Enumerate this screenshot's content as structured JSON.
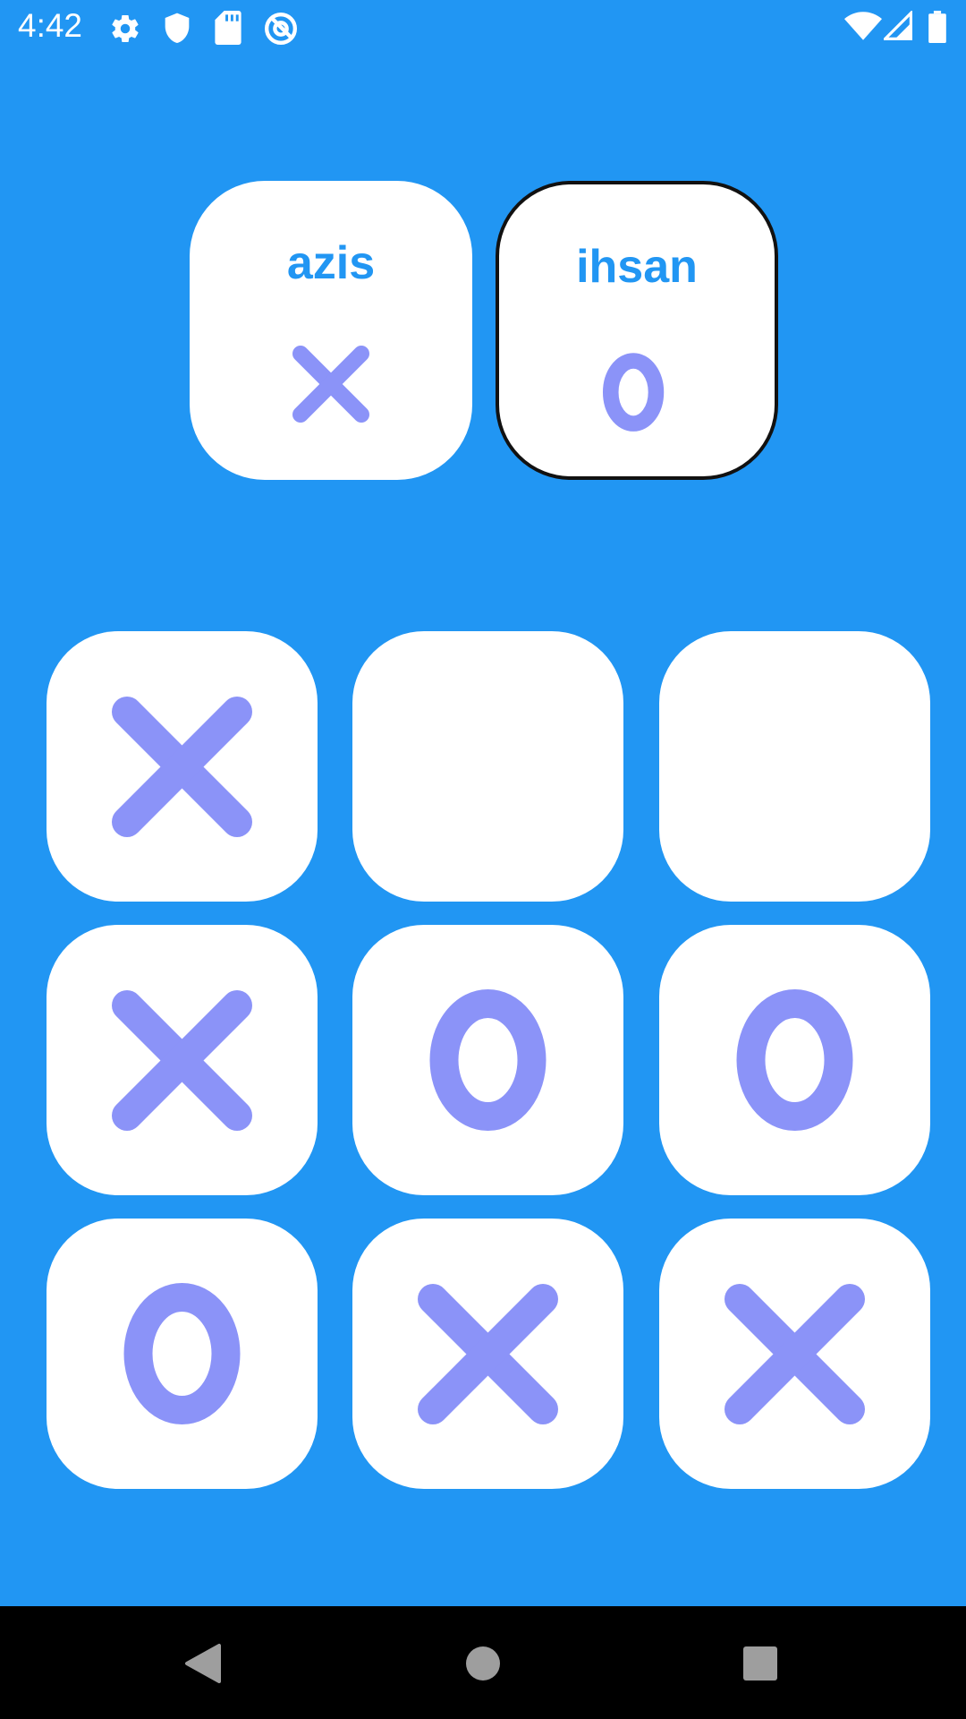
{
  "status_bar": {
    "time": "4:42",
    "left_icons": [
      "gear-icon",
      "shield-icon",
      "sd-card-icon",
      "at-sign-icon"
    ],
    "right_icons": [
      "wifi-icon",
      "cell-signal-icon",
      "battery-icon"
    ]
  },
  "players": [
    {
      "name": "azis",
      "mark": "X",
      "active": false
    },
    {
      "name": "ihsan",
      "mark": "O",
      "active": true
    }
  ],
  "board": {
    "cells": [
      "X",
      "",
      "",
      "X",
      "O",
      "O",
      "O",
      "X",
      "X"
    ]
  },
  "nav_bar": {
    "buttons": [
      "back-icon",
      "home-icon",
      "recents-icon"
    ]
  },
  "colors": {
    "background": "#2196F3",
    "card": "#FFFFFF",
    "mark": "#8B93F8",
    "name_text": "#2196F3",
    "active_border": "#111111",
    "nav_background": "#000000"
  }
}
